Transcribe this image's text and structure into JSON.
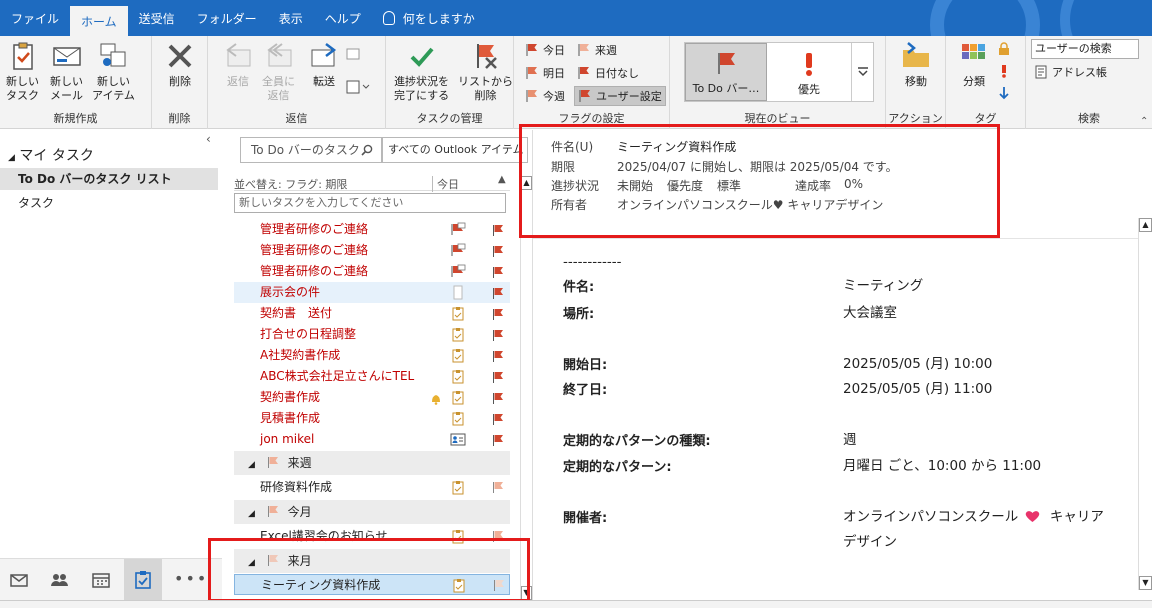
{
  "tabs": [
    "ファイル",
    "ホーム",
    "送受信",
    "フォルダー",
    "表示",
    "ヘルプ",
    "何をしますか"
  ],
  "ribbon": {
    "new_task": "新しい\nタスク",
    "new_mail": "新しい\nメール",
    "new_item": "新しい\nアイテム",
    "group_new": "新規作成",
    "delete": "削除",
    "group_delete": "削除",
    "reply": "返信",
    "reply_all": "全員に\n返信",
    "forward": "転送",
    "group_reply": "返信",
    "mark_complete": "進捗状況を\n完了にする",
    "remove_list": "リストから\n削除",
    "group_task_manage": "タスクの管理",
    "flag_today": "今日",
    "flag_tomorrow": "明日",
    "flag_this_week": "今週",
    "flag_next_week": "来週",
    "flag_no_date": "日付なし",
    "flag_custom": "ユーザー設定",
    "group_flag": "フラグの設定",
    "view_todo": "To Do バー…",
    "view_priority": "優先",
    "group_view": "現在のビュー",
    "move": "移動",
    "group_action": "アクション",
    "categorize": "分類",
    "group_tags": "タグ",
    "search_people": "ユーザーの検索",
    "address_book": "アドレス帳",
    "group_search": "検索"
  },
  "folder_pane": {
    "header": "マイ タスク",
    "items": [
      "To Do バーのタスク リスト",
      "タスク"
    ]
  },
  "task_pane": {
    "search_placeholder": "To Do バーのタスク",
    "scope": "すべての Outlook アイテム",
    "sort_label": "並べ替え: フラグ: 期限",
    "sort_col": "今日",
    "new_task_placeholder": "新しいタスクを入力してください",
    "rows_red": [
      {
        "title": "管理者研修のご連絡",
        "icon": "flag-recurring-icon"
      },
      {
        "title": "管理者研修のご連絡",
        "icon": "flag-recurring-icon"
      },
      {
        "title": "管理者研修のご連絡",
        "icon": "flag-recurring-icon"
      },
      {
        "title": "展示会の件",
        "icon": "empty-icon"
      },
      {
        "title": "契約書　送付",
        "icon": "task-icon"
      },
      {
        "title": "打合せの日程調整",
        "icon": "task-icon"
      },
      {
        "title": "A社契約書作成",
        "icon": "task-icon"
      },
      {
        "title": "ABC株式会社足立さんにTEL",
        "icon": "task-icon"
      },
      {
        "title": "契約書作成",
        "icon": "task-icon"
      },
      {
        "title": "見積書作成",
        "icon": "task-icon"
      },
      {
        "title": "jon mikel",
        "icon": "contact-icon"
      }
    ],
    "group_next_week": "来週",
    "row_next_week": "研修資料作成",
    "group_this_month": "今月",
    "row_this_month": "Excel講習会のお知らせ",
    "group_next_month": "来月",
    "row_next_month": "ミーティング資料作成"
  },
  "reading_pane": {
    "subject_label": "件名(U)",
    "subject_value": "ミーティング資料作成",
    "due_label": "期限",
    "due_value": "2025/04/07 に開始し、期限は 2025/05/04 です。",
    "status_label": "進捗状況",
    "status_value": "未開始",
    "priority_label": "優先度",
    "priority_value": "標準",
    "completion_label": "達成率",
    "completion_value": "0%",
    "owner_label": "所有者",
    "owner_value": "オンラインパソコンスクール♥ キャリアデザイン",
    "divider": "------------",
    "body": {
      "subject_label": "件名:",
      "subject_value": "ミーティング",
      "location_label": "場所:",
      "location_value": "大会議室",
      "start_label": "開始日:",
      "start_value": "2025/05/05 (月) 10:00",
      "end_label": "終了日:",
      "end_value": "2025/05/05 (月) 11:00",
      "pattern_type_label": "定期的なパターンの種類:",
      "pattern_type_value": "週",
      "pattern_label": "定期的なパターン:",
      "pattern_value": "月曜日  ごと、10:00  から  11:00",
      "organizer_label": "開催者:",
      "organizer_value_1": "オンラインパソコンスクール",
      "organizer_value_2": "キャリア",
      "organizer_value_3": "デザイン"
    }
  },
  "colors": {
    "accent": "#1e6bc0",
    "highlight_red": "#e41b1b",
    "task_red": "#c00000",
    "heart": "#e8336a"
  }
}
